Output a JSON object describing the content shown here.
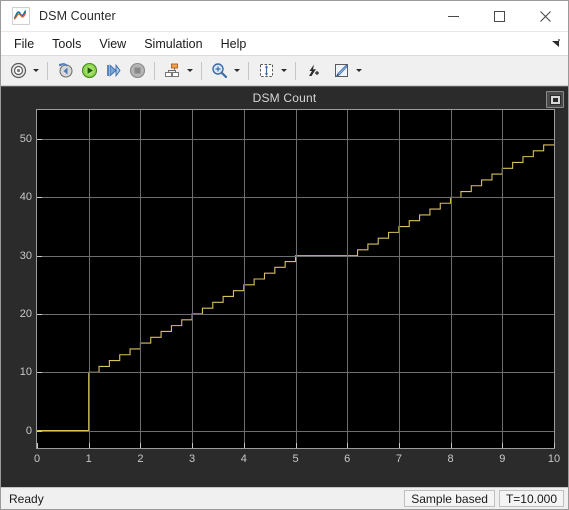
{
  "window": {
    "title": "DSM Counter",
    "app_icon": "simulink-scope-icon",
    "controls": {
      "minimize": "minimize-icon",
      "maximize": "maximize-icon",
      "close": "close-icon"
    }
  },
  "menubar": {
    "items": [
      {
        "label": "File",
        "name": "menu-file"
      },
      {
        "label": "Tools",
        "name": "menu-tools"
      },
      {
        "label": "View",
        "name": "menu-view"
      },
      {
        "label": "Simulation",
        "name": "menu-simulation"
      },
      {
        "label": "Help",
        "name": "menu-help"
      }
    ],
    "expand_icon": "menu-expand-arrow-icon"
  },
  "toolbar": {
    "buttons": [
      {
        "name": "configuration-properties-button",
        "icon": "gear-icon",
        "caret": true
      },
      {
        "name": "step-back-button",
        "icon": "step-back-icon",
        "caret": false
      },
      {
        "name": "run-button",
        "icon": "play-icon",
        "caret": false
      },
      {
        "name": "step-forward-button",
        "icon": "step-forward-icon",
        "caret": false
      },
      {
        "name": "stop-button",
        "icon": "stop-icon",
        "caret": false
      },
      {
        "name": "signal-selection-button",
        "icon": "signal-select-icon",
        "caret": true
      },
      {
        "name": "zoom-button",
        "icon": "zoom-in-icon",
        "caret": true
      },
      {
        "name": "autoscale-button",
        "icon": "autoscale-icon",
        "caret": true
      },
      {
        "name": "data-cursors-button",
        "icon": "cursor-measure-icon",
        "caret": false
      },
      {
        "name": "style-button",
        "icon": "pencil-style-icon",
        "caret": true
      }
    ]
  },
  "scope": {
    "title": "DSM Count",
    "corner_button_icon": "maximize-axes-icon",
    "background": "#000000",
    "grid_color": "#6e6e6e",
    "signal_color": "#d9c15c"
  },
  "statusbar": {
    "state": "Ready",
    "frame_mode": "Sample based",
    "time": "T=10.000"
  },
  "chart_data": {
    "type": "line",
    "title": "DSM Count",
    "xlabel": "",
    "ylabel": "",
    "xlim": [
      0,
      10
    ],
    "ylim": [
      -3,
      55
    ],
    "xticks": [
      0,
      1,
      2,
      3,
      4,
      5,
      6,
      7,
      8,
      9,
      10
    ],
    "yticks": [
      0,
      10,
      20,
      30,
      40,
      50
    ],
    "grid": true,
    "legend": false,
    "line_color": "#d9c15c",
    "step_style": "staircase",
    "description": "Counter output: holds 0 until t=1, jumps to 10, increments by 1 every 0.2 s up to 30 at t=5, holds 30 until t=6, then resumes incrementing by 1 every 0.2 s to ~49 at t=10.",
    "x": [
      0.0,
      0.2,
      0.4,
      0.6,
      0.8,
      1.0,
      1.2,
      1.4,
      1.6,
      1.8,
      2.0,
      2.2,
      2.4,
      2.6,
      2.8,
      3.0,
      3.2,
      3.4,
      3.6,
      3.8,
      4.0,
      4.2,
      4.4,
      4.6,
      4.8,
      5.0,
      5.2,
      5.4,
      5.6,
      5.8,
      6.0,
      6.2,
      6.4,
      6.6,
      6.8,
      7.0,
      7.2,
      7.4,
      7.6,
      7.8,
      8.0,
      8.2,
      8.4,
      8.6,
      8.8,
      9.0,
      9.2,
      9.4,
      9.6,
      9.8,
      10.0
    ],
    "y": [
      0,
      0,
      0,
      0,
      0,
      10,
      11,
      12,
      13,
      14,
      15,
      16,
      17,
      18,
      19,
      20,
      21,
      22,
      23,
      24,
      25,
      26,
      27,
      28,
      29,
      30,
      30,
      30,
      30,
      30,
      30,
      31,
      32,
      33,
      34,
      35,
      36,
      37,
      38,
      39,
      40,
      41,
      42,
      43,
      44,
      45,
      46,
      47,
      48,
      49,
      49
    ]
  }
}
